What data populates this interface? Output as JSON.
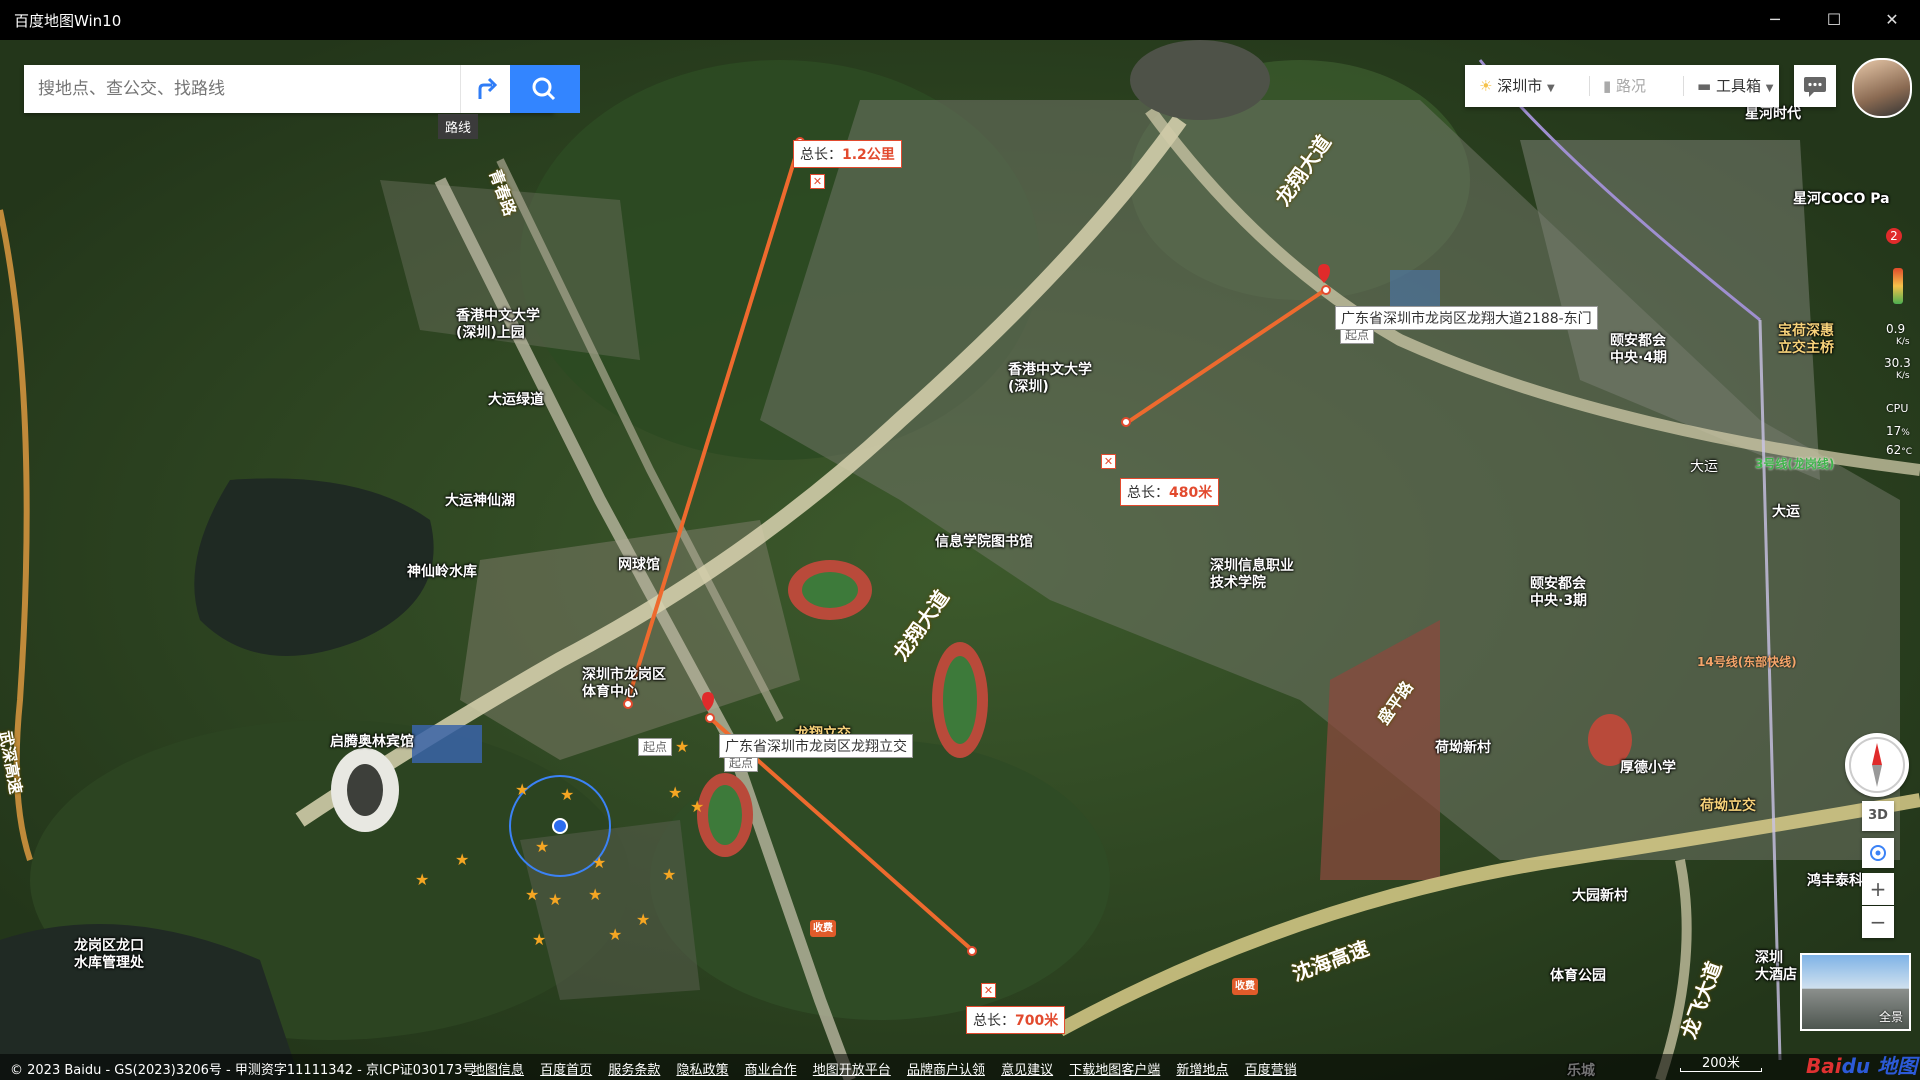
{
  "window": {
    "title": "百度地图Win10",
    "minimize": "─",
    "maximize": "☐",
    "close": "✕"
  },
  "search": {
    "placeholder": "搜地点、查公交、找路线",
    "route_tooltip": "路线",
    "route_icon": "route-arrow-icon",
    "search_icon": "magnifier-icon"
  },
  "toolbar": {
    "city": "深圳市",
    "traffic": "路况",
    "tools": "工具箱",
    "weather_icon": "sun-icon",
    "messages_icon": "chat-icon"
  },
  "side_stats": {
    "badge": "2",
    "up_speed": "0.9",
    "up_unit": "K/s",
    "down_speed": "30.3",
    "down_unit": "K/s",
    "cpu_label": "CPU",
    "cpu_value": "17",
    "cpu_unit": "%",
    "temp_value": "62",
    "temp_unit": "°C"
  },
  "measurements": [
    {
      "total_label": "总长：",
      "value": "1.2公里"
    },
    {
      "total_label": "总长：",
      "value": "480米"
    },
    {
      "total_label": "总长：",
      "value": "700米"
    }
  ],
  "start_tag": "起点",
  "addresses": {
    "east_gate": "广东省深圳市龙岗区龙翔大道2188-东门",
    "longxiang_interchange": "广东省深圳市龙岗区龙翔立交"
  },
  "pois": {
    "cuhk_upper": "香港中文大学\n(深圳)上园",
    "dayun_greenway": "大运绿道",
    "dayun_lake": "大运神仙湖",
    "shenxianling": "神仙岭水库",
    "tennis": "网球馆",
    "sports_center": "深圳市龙岗区\n体育中心",
    "qiteng_hotel": "启腾奥林宾馆",
    "longkou_reservoir": "龙岗区龙口\n水库管理处",
    "cuhk": "香港中文大学\n(深圳)",
    "library": "信息学院图书馆",
    "sz_info_college": "深圳信息职业\n技术学院",
    "longxiang_ic": "龙翔立交",
    "xinghe_times": "星河时代",
    "xinghe_coco": "星河COCO Pa",
    "yian_4": "颐安都会\n中央·4期",
    "yian_3": "颐安都会\n中央·3期",
    "baohe_bridge": "宝荷深惠\n立交主桥",
    "dayun_station": "大运",
    "dayun_area": "大运",
    "heao_village": "荷坳新村",
    "houde_school": "厚德小学",
    "heao_ic": "荷坳立交",
    "hongfeng": "鸿丰泰科",
    "dayuan_village": "大园新村",
    "sports_park": "体育公园",
    "sz_hotel": "深圳\n大酒店",
    "lecheng": "乐城",
    "toll_1": "收费",
    "toll_2": "收费"
  },
  "roads": {
    "longxiang_top": "龙翔大道",
    "longxiang_mid": "龙翔大道",
    "longfei": "龙飞大道",
    "shenhai": "沈海高速",
    "qingchun": "青春路",
    "wushen": "武深高速",
    "shiyue": "盛平路"
  },
  "metro": {
    "line3": "3号线(龙岗线)",
    "line14": "14号线(东部快线)"
  },
  "map_controls": {
    "compass_icon": "compass-icon",
    "three_d": "3D",
    "locate_icon": "locate-icon",
    "zoom_in": "+",
    "zoom_out": "−",
    "panorama": "全景"
  },
  "footer": {
    "copyright": "© 2023 Baidu - GS(2023)3206号 - 甲测资字11111342 - 京ICP证030173号",
    "links": [
      "地图信息",
      "百度首页",
      "服务条款",
      "隐私政策",
      "商业合作",
      "地图开放平台",
      "品牌商户认领",
      "意见建议",
      "下载地图客户端",
      "新增地点",
      "百度营销"
    ],
    "scale": "200米",
    "logo_a": "Bai",
    "logo_b": "du 地图"
  }
}
